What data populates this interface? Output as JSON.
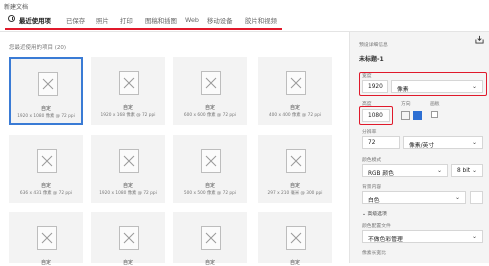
{
  "window": {
    "title": "新建文档"
  },
  "tabs": [
    {
      "label": "最近使用项"
    },
    {
      "label": "已保存"
    },
    {
      "label": "照片"
    },
    {
      "label": "打印"
    },
    {
      "label": "图稿和插图"
    },
    {
      "label": "Web"
    },
    {
      "label": "移动设备"
    },
    {
      "label": "胶片和视频"
    }
  ],
  "recent": {
    "title": "您最近使用的项目 (20)",
    "items": [
      {
        "name": "自定",
        "spec": "1920 x 1080 像素 @ 72 ppi"
      },
      {
        "name": "自定",
        "spec": "1920 x 168 像素 @ 72 ppi"
      },
      {
        "name": "自定",
        "spec": "600 x 600 像素 @ 72 ppi"
      },
      {
        "name": "自定",
        "spec": "400 x 400 像素 @ 72 ppi"
      },
      {
        "name": "自定",
        "spec": "636 x 431 像素 @ 72 ppi"
      },
      {
        "name": "自定",
        "spec": "1920 x 1080 像素 @ 72 ppi"
      },
      {
        "name": "自定",
        "spec": "500 x 500 像素 @ 72 ppi"
      },
      {
        "name": "自定",
        "spec": "297 x 210 毫米 @ 300 ppi"
      },
      {
        "name": "自定",
        "spec": ""
      },
      {
        "name": "自定",
        "spec": ""
      },
      {
        "name": "自定",
        "spec": ""
      },
      {
        "name": "自定",
        "spec": ""
      }
    ]
  },
  "details": {
    "header": "预设详细信息",
    "doc_name": "未标题-1",
    "width_label": "宽度",
    "width_value": "1920",
    "width_unit": "像素",
    "height_label": "高度",
    "height_value": "1080",
    "orientation_label": "方向",
    "artboard_label": "画板",
    "resolution_label": "分辨率",
    "resolution_value": "72",
    "resolution_unit": "像素/英寸",
    "color_mode_label": "颜色模式",
    "color_mode_value": "RGB 颜色",
    "bit_depth": "8 bit",
    "background_label": "背景内容",
    "background_value": "白色",
    "advanced_label": "高级选项",
    "profile_label": "颜色配置文件",
    "profile_value": "不做色彩管理",
    "pixel_aspect_label": "像素长宽比"
  }
}
